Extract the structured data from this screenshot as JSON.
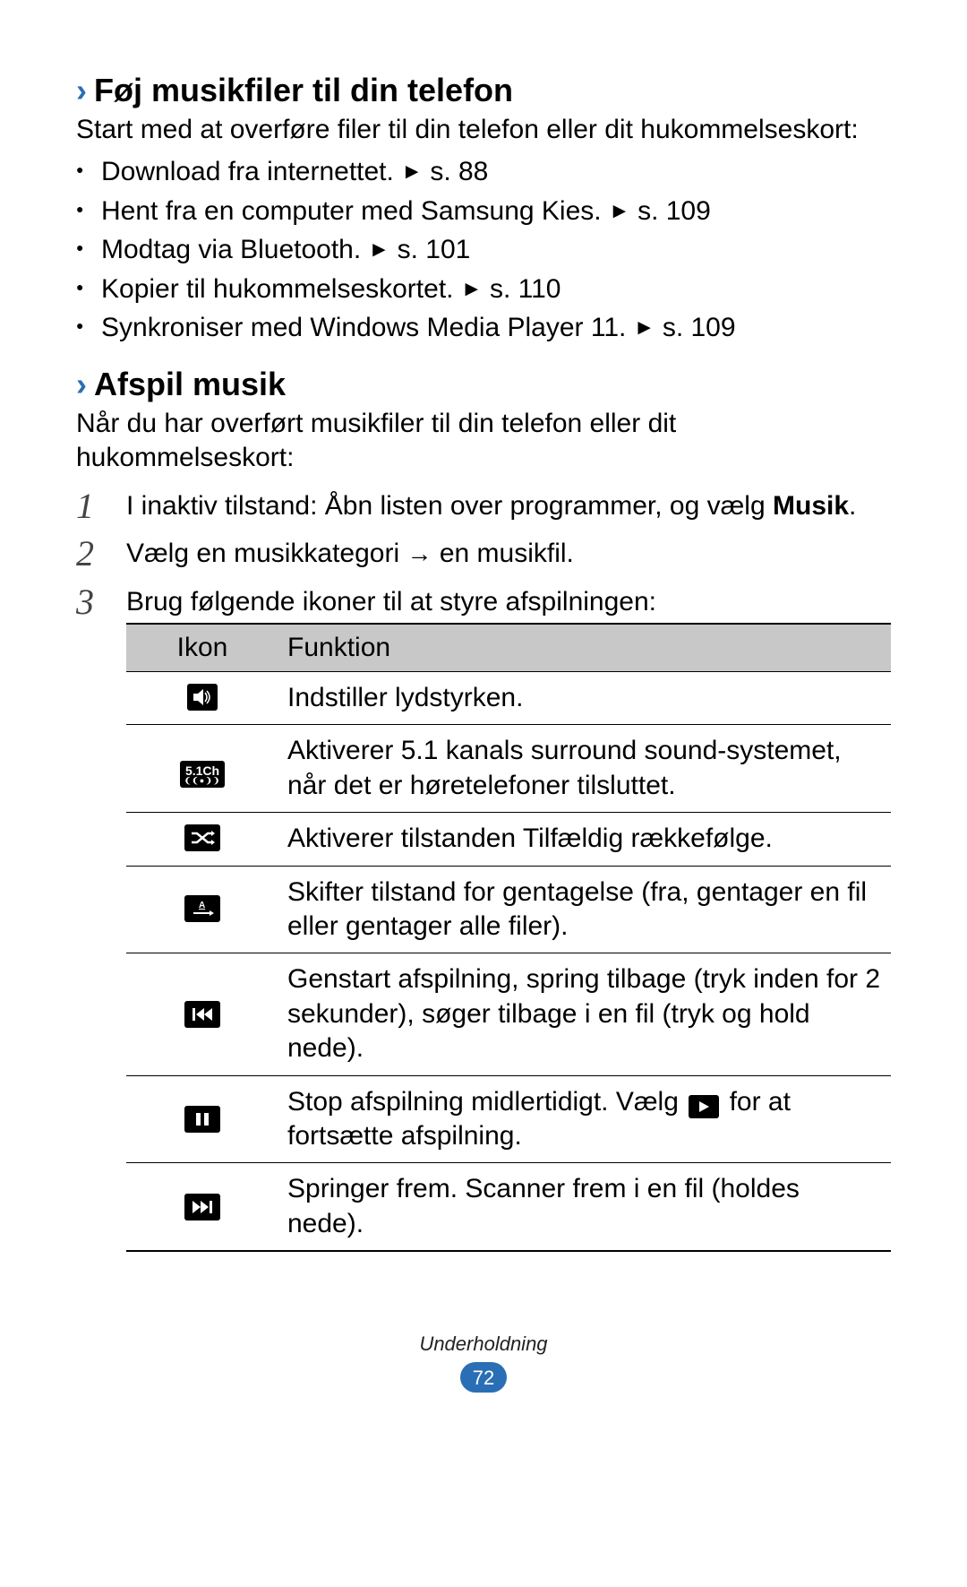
{
  "section1": {
    "heading": "Føj musikfiler til din telefon",
    "intro": "Start med at overføre filer til din telefon eller dit hukommelseskort:",
    "bullets": [
      {
        "text": "Download fra internettet.",
        "ref": "s. 88"
      },
      {
        "text": "Hent fra en computer med Samsung Kies.",
        "ref": "s. 109"
      },
      {
        "text": "Modtag via Bluetooth.",
        "ref": "s. 101"
      },
      {
        "text": "Kopier til hukommelseskortet.",
        "ref": "s. 110"
      },
      {
        "text": "Synkroniser med Windows Media Player 11.",
        "ref": "s. 109"
      }
    ]
  },
  "section2": {
    "heading": "Afspil musik",
    "intro": "Når du har overført musikfiler til din telefon eller dit hukommelseskort:",
    "step1_pre": "I inaktiv tilstand: Åbn listen over programmer, og vælg ",
    "step1_bold": "Musik",
    "step1_post": ".",
    "step2_pre": "Vælg en musikkategori ",
    "step2_post": " en musikfil.",
    "step3": "Brug følgende ikoner til at styre afspilningen:"
  },
  "table": {
    "header_icon": "Ikon",
    "header_func": "Funktion",
    "rows": [
      {
        "desc": "Indstiller lydstyrken."
      },
      {
        "desc": "Aktiverer 5.1 kanals surround sound-systemet, når det er høretelefoner tilsluttet."
      },
      {
        "desc": "Aktiverer tilstanden Tilfældig rækkefølge."
      },
      {
        "desc": "Skifter tilstand for gentagelse (fra, gentager en fil eller gentager alle filer)."
      },
      {
        "desc": "Genstart afspilning, spring tilbage (tryk inden for 2 sekunder), søger tilbage i en fil (tryk og hold nede)."
      },
      {
        "desc_pre": "Stop afspilning midlertidigt. Vælg ",
        "desc_post": " for at fortsætte afspilning."
      },
      {
        "desc": "Springer frem. Scanner frem i en fil (holdes nede)."
      }
    ]
  },
  "footer": {
    "section": "Underholdning",
    "page": "72"
  },
  "glyphs": {
    "chevron": "›",
    "ref_arrow": "►",
    "step_arrow": "→",
    "volume": "◀))",
    "fiveone_top": "5.1Ch",
    "fiveone_bot": "❨❨●❩❩",
    "shuffle": "⤨",
    "repeat_a": "A",
    "repeat_arr": "→",
    "prev": "▐◀◀",
    "pause": "▮▮",
    "play": "▶",
    "next": "▶▶▌"
  }
}
